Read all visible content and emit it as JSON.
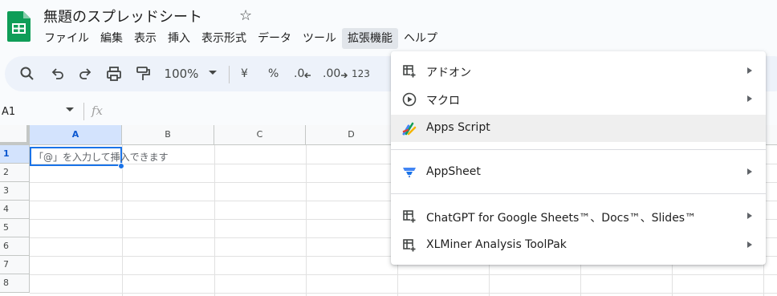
{
  "app": {
    "doc_title": "無題のスプレッドシート"
  },
  "menubar": {
    "items": [
      {
        "label": "ファイル",
        "active": false
      },
      {
        "label": "編集",
        "active": false
      },
      {
        "label": "表示",
        "active": false
      },
      {
        "label": "挿入",
        "active": false
      },
      {
        "label": "表示形式",
        "active": false
      },
      {
        "label": "データ",
        "active": false
      },
      {
        "label": "ツール",
        "active": false
      },
      {
        "label": "拡張機能",
        "active": true
      },
      {
        "label": "ヘルプ",
        "active": false
      }
    ]
  },
  "toolbar": {
    "zoom": "100%",
    "currency": "¥",
    "percent": "%",
    "dec_decrease": ".0",
    "dec_increase": ".00",
    "number_format": "123"
  },
  "formula_bar": {
    "name_box": "A1",
    "fx": "fx"
  },
  "grid": {
    "columns": [
      "A",
      "B",
      "C",
      "D"
    ],
    "rows": [
      "1",
      "2",
      "3",
      "4",
      "5",
      "6",
      "7",
      "8"
    ],
    "active_cell_hint": "「@」を入力して挿入できます"
  },
  "extensions_menu": {
    "items": [
      {
        "label": "アドオン",
        "icon": "addon-icon",
        "submenu": true
      },
      {
        "label": "マクロ",
        "icon": "macro-play-icon",
        "submenu": true
      },
      {
        "label": "Apps Script",
        "icon": "apps-script-icon",
        "submenu": false
      },
      {
        "label": "AppSheet",
        "icon": "appsheet-icon",
        "submenu": true
      },
      {
        "label": "ChatGPT for Google Sheets™、Docs™、Slides™",
        "icon": "addon-icon",
        "submenu": true
      },
      {
        "label": "XLMiner Analysis ToolPak",
        "icon": "addon-icon",
        "submenu": true
      }
    ]
  },
  "colors": {
    "accent": "#1a73e8",
    "sheets_green": "#0f9d58",
    "toolbar_bg": "#edf2fa"
  }
}
